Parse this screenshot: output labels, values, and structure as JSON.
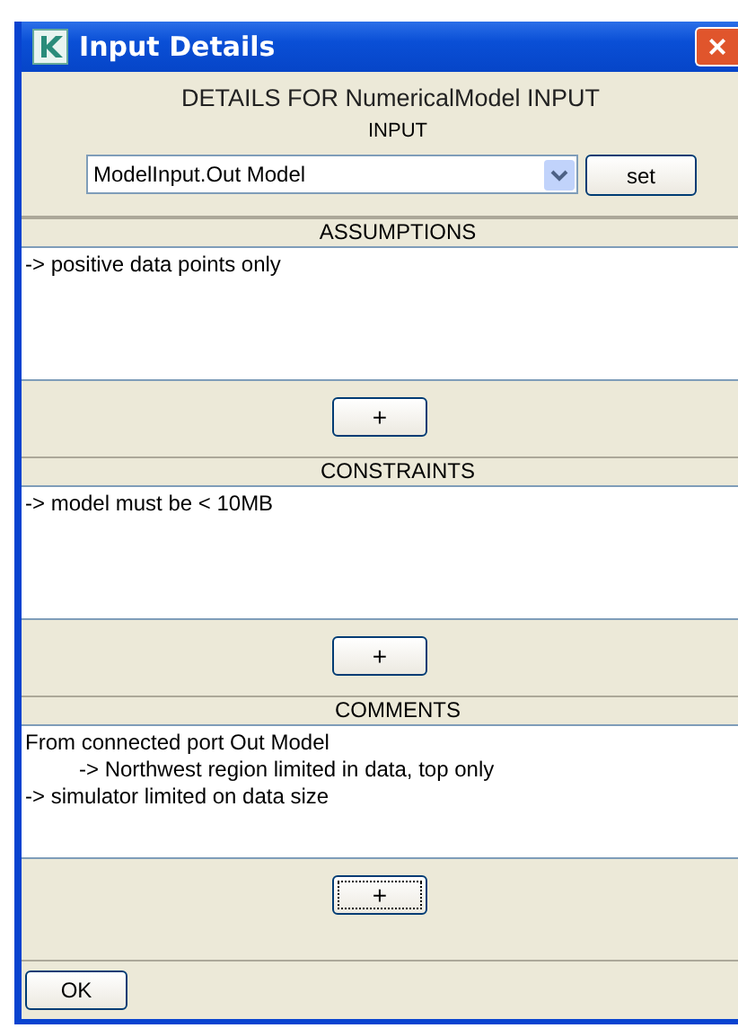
{
  "window": {
    "title": "Input Details",
    "close": "×"
  },
  "heading": "DETAILS FOR NumericalModel INPUT",
  "input": {
    "label": "INPUT",
    "value": "ModelInput.Out Model",
    "button": "set"
  },
  "sections": [
    {
      "title": "ASSUMPTIONS",
      "lines": [
        {
          "text": "-> positive data points only"
        }
      ],
      "add_button": {
        "label": "+",
        "focused": false
      }
    },
    {
      "title": "CONSTRAINTS",
      "lines": [
        {
          "text": "-> model must be < 10MB"
        }
      ],
      "add_button": {
        "label": "+",
        "focused": false
      }
    },
    {
      "title": "COMMENTS",
      "lines": [
        {
          "text": "From connected port Out Model",
          "children": [
            {
              "text": "-> Northwest region limited in data, top only"
            }
          ]
        },
        {
          "text": "-> simulator limited on data size"
        }
      ],
      "add_button": {
        "label": "+",
        "focused": true
      }
    }
  ],
  "buttons": [
    "OK"
  ]
}
